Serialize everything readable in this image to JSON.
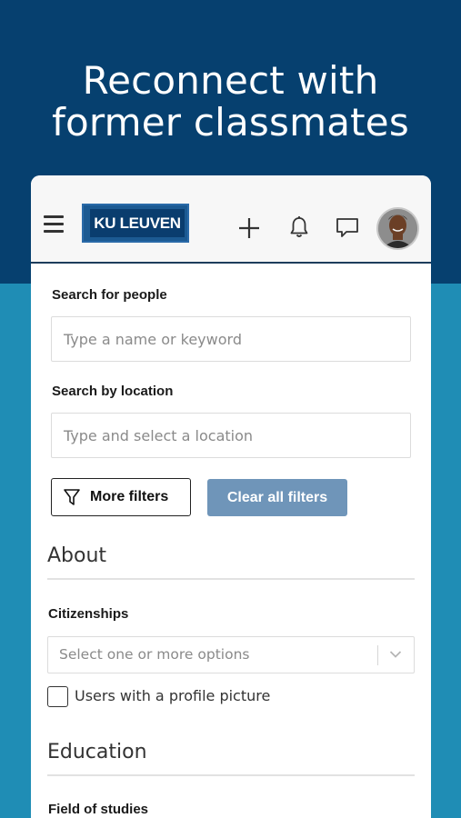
{
  "promo": {
    "headline_line1": "Reconnect with",
    "headline_line2": "former classmates"
  },
  "appbar": {
    "menu_icon": "hamburger-menu-icon",
    "logo_text": "KU LEUVEN",
    "add_icon": "plus-icon",
    "notifications_icon": "bell-icon",
    "messages_icon": "chat-bubble-icon",
    "avatar_icon": "user-avatar"
  },
  "search": {
    "people_label": "Search for people",
    "people_placeholder": "Type a name or keyword",
    "location_label": "Search by location",
    "location_placeholder": "Type and select a location",
    "more_filters_label": "More filters",
    "clear_filters_label": "Clear all filters"
  },
  "about": {
    "title": "About",
    "citizenships_label": "Citizenships",
    "citizenships_placeholder": "Select one or more options",
    "profile_picture_checkbox_label": "Users with a profile picture",
    "profile_picture_checked": false
  },
  "education": {
    "title": "Education",
    "field_of_studies_label": "Field of studies"
  },
  "colors": {
    "header_dark_blue": "#06406f",
    "background_teal": "#1f8db5",
    "clear_button": "#6f95b9",
    "logo_blue": "#0a3d6e"
  }
}
